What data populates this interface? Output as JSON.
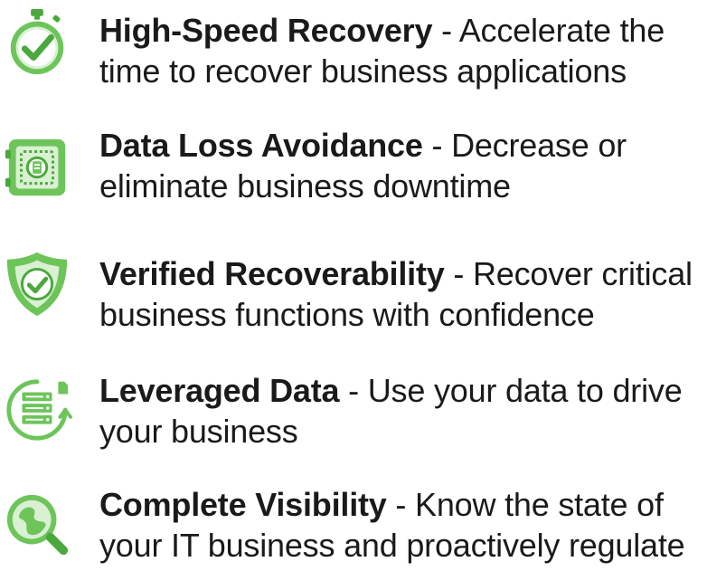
{
  "colors": {
    "accent": "#6dc55a",
    "accent_dark": "#4aa83c",
    "accent_light": "#d9f0d2",
    "text": "#1a1a1a"
  },
  "features": [
    {
      "icon": "stopwatch-check-icon",
      "title": "High-Speed Recovery",
      "separator": " - ",
      "description": "Accelerate the time to recover business applications"
    },
    {
      "icon": "vault-safe-icon",
      "title": "Data Loss Avoidance",
      "separator": " - ",
      "description": "Decrease or eliminate business downtime"
    },
    {
      "icon": "shield-check-icon",
      "title": "Verified Recoverability",
      "separator": " - ",
      "description": "Recover critical business functions with confidence"
    },
    {
      "icon": "database-sync-icon",
      "title": "Leveraged Data",
      "separator": " - ",
      "description": "Use your data to drive your business"
    },
    {
      "icon": "globe-magnifier-icon",
      "title": "Complete Visibility",
      "separator": " - ",
      "description": "Know the state of your IT business and proactively regulate"
    }
  ]
}
